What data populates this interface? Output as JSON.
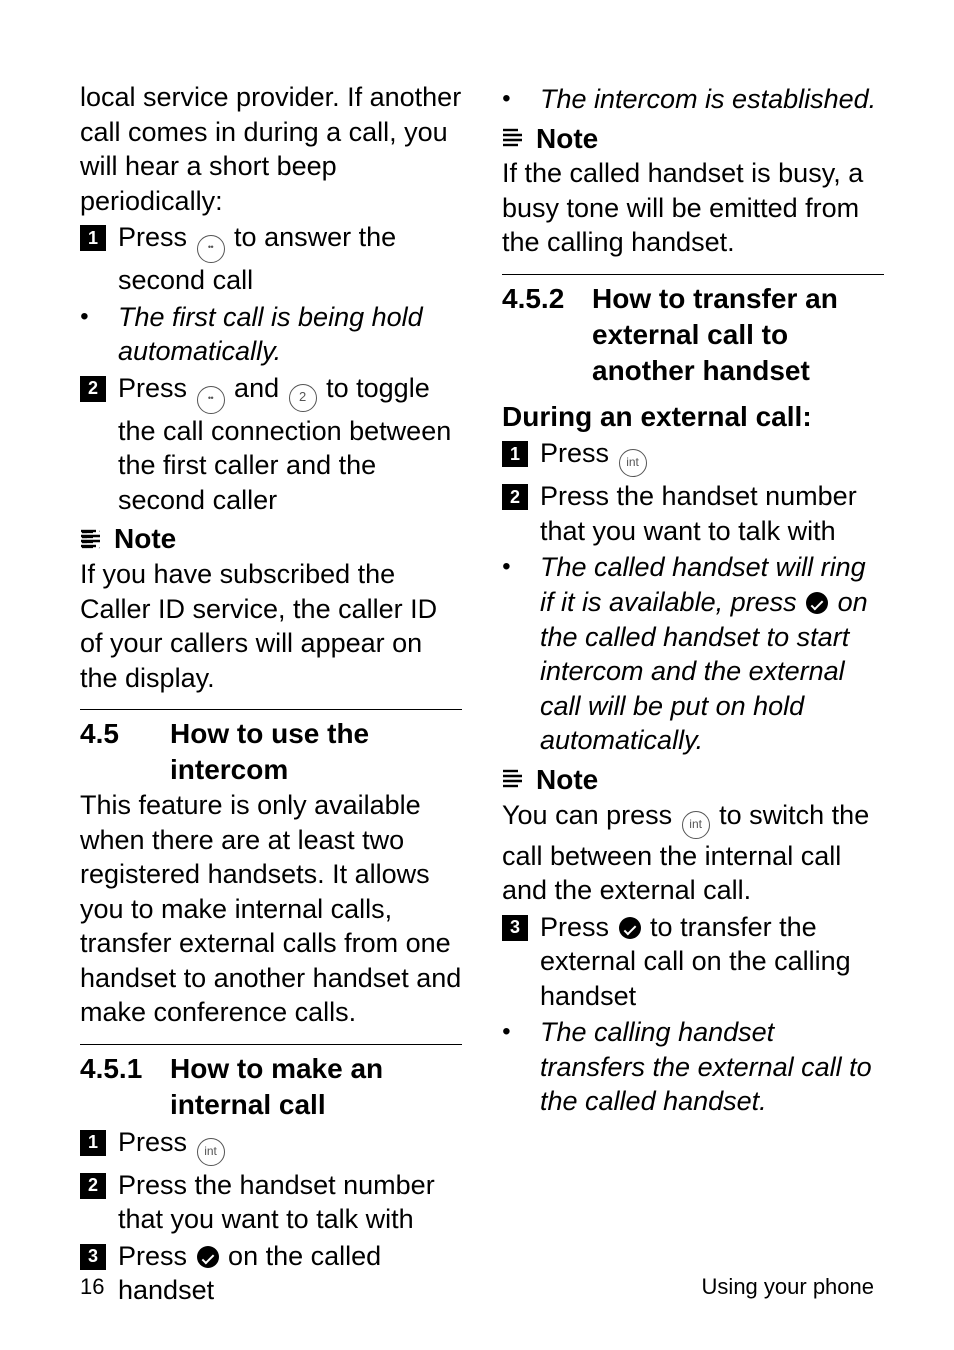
{
  "left": {
    "intro": "local service provider. If another call comes in during a call, you will hear a short beep periodically:",
    "step1": "to answer the second call",
    "step1_prefix": "Press ",
    "bullet1": "The first call is being hold automatically.",
    "step2_prefix": "Press ",
    "step2_mid": " and ",
    "step2_suffix": " to toggle the call connection between the first caller and the second caller",
    "note_label": "Note",
    "note_body": "If you have subscribed the Caller ID service, the caller ID of your callers will appear on the display.",
    "sec45_num": "4.5",
    "sec45_title": "How to use the intercom",
    "sec45_body": "This feature is only available when there are at least two registered handsets.  It allows you to make internal calls, transfer external calls from one handset to another handset and make conference calls.",
    "sec451_num": "4.5.1",
    "sec451_title": "How to make an internal call",
    "s451_1": "Press ",
    "s451_2": "Press the handset number that you want to talk with",
    "s451_3_prefix": "Press ",
    "s451_3_suffix": " on the called handset"
  },
  "right": {
    "top_bullet": "The intercom is established.",
    "note_label": "Note",
    "note_body": "If the called handset is busy, a busy tone will be emitted from the calling handset.",
    "sec452_num": "4.5.2",
    "sec452_title": "How to transfer an external call to another handset",
    "during": "During an external call:",
    "s1": "Press ",
    "s2": "Press the handset number that you want to talk with",
    "b1_prefix": "The called handset will ring if it is available, press ",
    "b1_suffix": " on the called handset to start intercom and the external call will be put on hold automatically.",
    "note2_label": "Note",
    "note2_prefix": "You can press ",
    "note2_suffix": " to switch the call between the internal call and the external call.",
    "s3_prefix": "Press ",
    "s3_suffix": " to transfer the external call on the calling handset",
    "b_last": "The calling handset transfers the external call to the called handset."
  },
  "footer": {
    "page": "16",
    "section": "Using your phone"
  },
  "icons": {
    "r": "R",
    "two": "2",
    "int": "int"
  }
}
